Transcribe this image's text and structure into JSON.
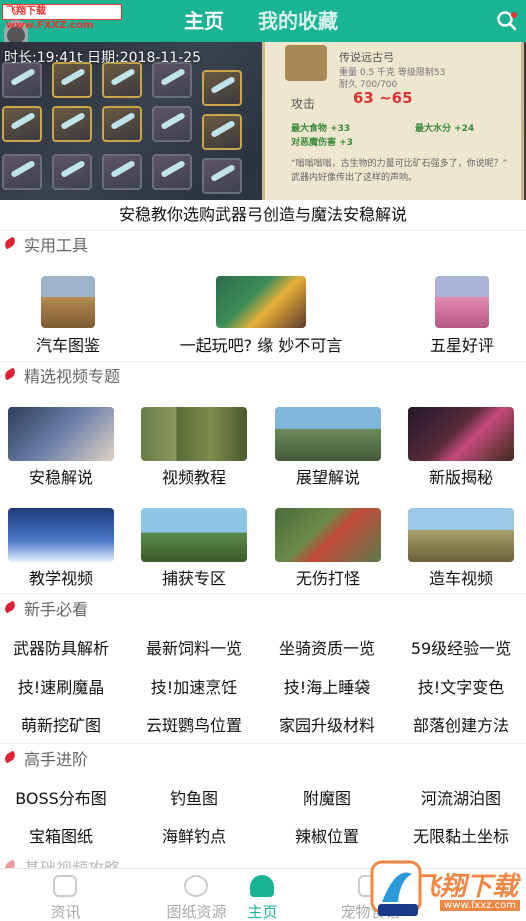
{
  "watermark_top": "飞翔下载 www.FXXZ.com",
  "header": {
    "tab_home": "主页",
    "tab_favorites": "我的收藏",
    "search_icon": "search-icon",
    "accent": "#1ab394"
  },
  "banner": {
    "meta": "时长:19:41t   日期:2018-11-25",
    "card_title": "传说远古弓",
    "card_weight": "重量   0.5 千克   等级限制53",
    "card_durability": "耐久   700/700",
    "card_attack_label": "攻击",
    "card_attack_range": "63 ~65",
    "card_stat_1": "最大食物 +33",
    "card_stat_2": "最大水分 +24",
    "card_stat_3": "对恶魔伤害 +3",
    "card_desc": "“嗡嗡嗡嗡，古生物的力量可比矿石强多了，你说呢？”  武器内好像传出了这样的声响。",
    "caption": "安稳教你选购武器弓创造与魔法安稳解说"
  },
  "sections": {
    "tools": "实用工具",
    "videos": "精选视频专题",
    "newbie": "新手必看",
    "advanced": "高手进阶",
    "basic_videos": "基础视频攻略"
  },
  "tools": [
    {
      "label": "汽车图鉴"
    },
    {
      "label": "一起玩吧? 缘 妙不可言"
    },
    {
      "label": "五星好评"
    }
  ],
  "videos": [
    {
      "label": "安稳解说"
    },
    {
      "label": "视频教程"
    },
    {
      "label": "展望解说"
    },
    {
      "label": "新版揭秘"
    },
    {
      "label": "教学视频"
    },
    {
      "label": "捕获专区"
    },
    {
      "label": "无伤打怪"
    },
    {
      "label": "造车视频"
    }
  ],
  "newbie_links": [
    "武器防具解析",
    "最新饲料一览",
    "坐骑资质一览",
    "59级经验一览",
    "技!速刷魔晶",
    "技!加速烹饪",
    "技!海上睡袋",
    "技!文字变色",
    "萌新挖矿图",
    "云斑鹦鸟位置",
    "家园升级材料",
    "部落创建方法"
  ],
  "advanced_links": [
    "BOSS分布图",
    "钓鱼图",
    "附魔图",
    "河流湖泊图",
    "宝箱图纸",
    "海鲜钓点",
    "辣椒位置",
    "无限黏土坐标"
  ],
  "bottom_nav": [
    {
      "label": "资讯"
    },
    {
      "label": "图纸资源"
    },
    {
      "label": "主页"
    },
    {
      "label": "宠物食谱"
    }
  ],
  "logo_watermark": "飞翔下载",
  "logo_url": "www.fxxz.com"
}
